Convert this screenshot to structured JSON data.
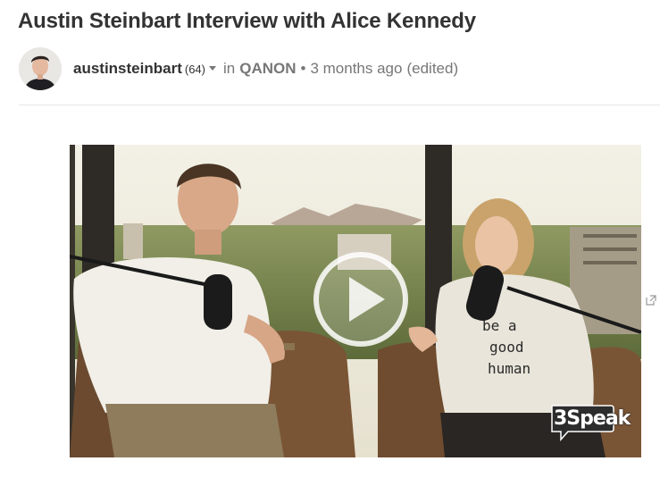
{
  "post": {
    "title": "Austin Steinbart Interview with Alice Kennedy",
    "author": "austinsteinbart",
    "reputation": "(64)",
    "in_label": "in",
    "community": "QANON",
    "separator": "•",
    "age": "3 months ago",
    "edited": "(edited)"
  },
  "video": {
    "watermark": "3Speak",
    "shirt_lines": [
      "be a",
      "good",
      "human"
    ]
  },
  "icons": {
    "play": "play-icon",
    "author_menu": "chevron-down-icon",
    "external": "external-link-icon"
  },
  "colors": {
    "title": "#333333",
    "meta": "#777777",
    "divider": "#e6e6e6"
  }
}
